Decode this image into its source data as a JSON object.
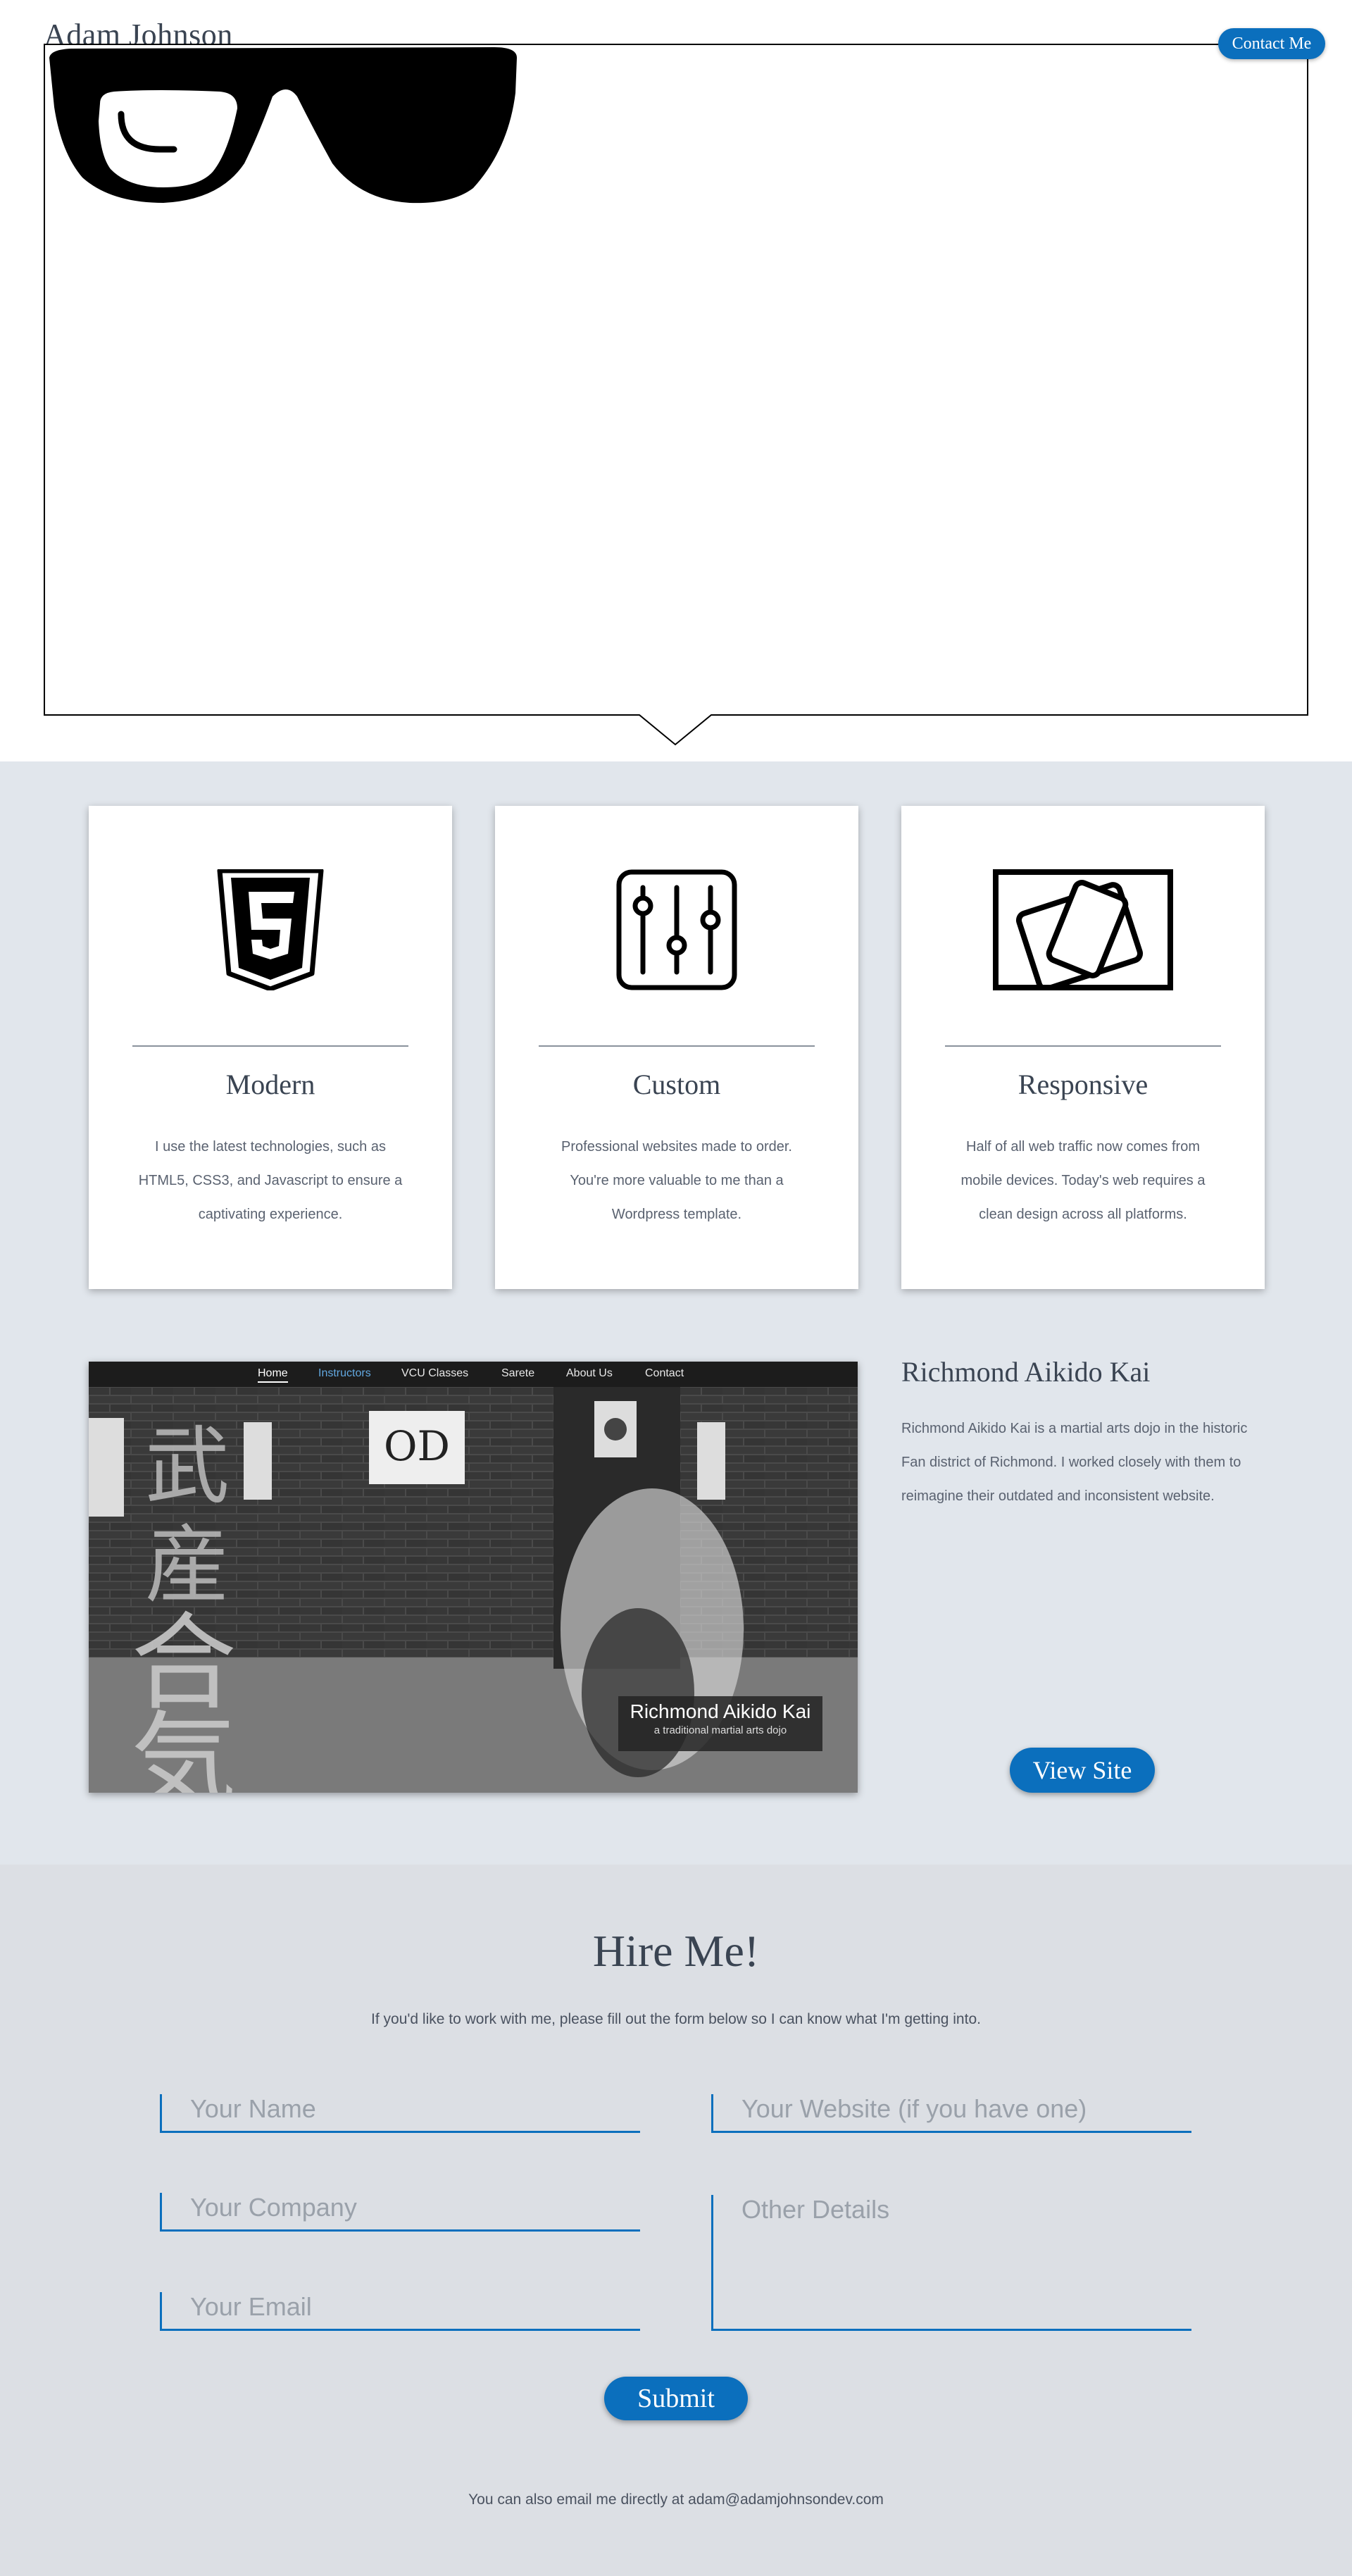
{
  "header": {
    "name": "Adam Johnson",
    "contact_label": "Contact Me"
  },
  "services": [
    {
      "title": "Modern",
      "text": "I use the latest technologies, such as HTML5, CSS3, and Javascript to ensure a captivating experience.",
      "icon": "html5-icon"
    },
    {
      "title": "Custom",
      "text": "Professional websites made to order. You're more valuable to me than a Wordpress template.",
      "icon": "sliders-icon"
    },
    {
      "title": "Responsive",
      "text": "Half of all web traffic now comes from mobile devices. Today's web requires a clean design across all platforms.",
      "icon": "devices-icon"
    }
  ],
  "project": {
    "title": "Richmond Aikido Kai",
    "description": "Richmond Aikido Kai is a martial arts dojo in the historic Fan district of Richmond. I worked closely with them to reimagine their outdated and inconsistent website.",
    "button": "View Site",
    "screenshot": {
      "nav": [
        "Home",
        "Instructors",
        "VCU Classes",
        "Sarete",
        "About Us",
        "Contact"
      ],
      "caption_title": "Richmond Aikido Kai",
      "caption_sub": "a traditional martial arts dojo"
    }
  },
  "hire": {
    "title": "Hire Me!",
    "intro": "If you'd like to work with me, please fill out the form below so I can know what I'm getting into.",
    "name_placeholder": "Your Name",
    "company_placeholder": "Your Company",
    "email_placeholder": "Your Email",
    "website_placeholder": "Your Website (if you have one)",
    "details_placeholder": "Other Details",
    "submit": "Submit",
    "footer": "You can also email me directly at adam@adamjohnsondev.com"
  },
  "colors": {
    "accent": "#0b6fbd",
    "section_bg": "#e1e6ec",
    "hire_bg": "#dcdfe4"
  }
}
